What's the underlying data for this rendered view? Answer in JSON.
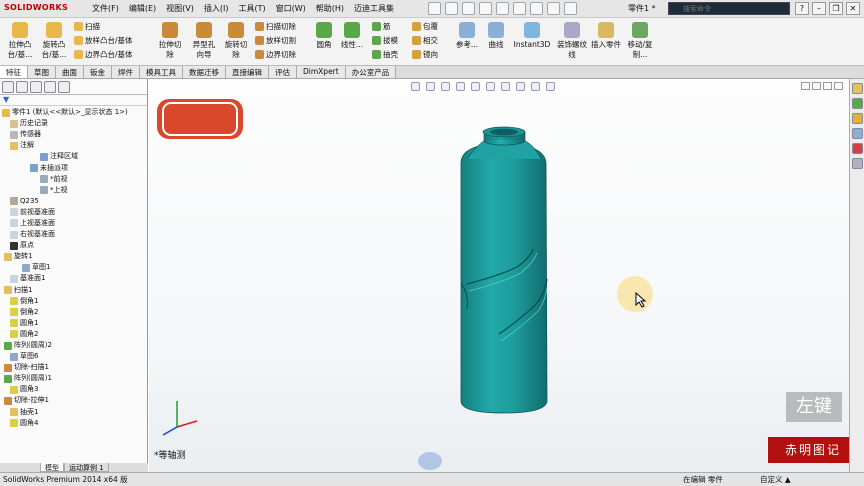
{
  "app": {
    "logo": "SOLIDWORKS",
    "menus": [
      "文件(F)",
      "编辑(E)",
      "视图(V)",
      "插入(I)",
      "工具(T)",
      "窗口(W)",
      "帮助(H)",
      "迈迪工具集"
    ],
    "doc_title": "零件1 *",
    "search_placeholder": "搜索命令"
  },
  "ribbon": {
    "big_buttons": [
      "拉伸凸台/基...",
      "旋转凸台/基...",
      "拉伸切除",
      "异型孔向导",
      "旋转切除",
      "圆角",
      "线性...",
      "参考...",
      "曲线",
      "Instant3D",
      "装饰螺纹线",
      "插入零件",
      "移动/复制..."
    ],
    "small_features": [
      "扫描",
      "放样凸台/基体",
      "边界凸台/基体"
    ],
    "small_cuts": [
      "扫描切除",
      "放样切割",
      "边界切除"
    ],
    "small_misc": [
      "筋",
      "拔模",
      "抽壳"
    ],
    "small_misc2": [
      "包覆",
      "相交",
      "镜向"
    ]
  },
  "tabs": [
    "特征",
    "草图",
    "曲面",
    "钣金",
    "焊件",
    "模具工具",
    "数据迁移",
    "直接编辑",
    "评估",
    "DimXpert",
    "办公室产品"
  ],
  "tree": {
    "root": "零件1 (默认<<默认>_显示状态 1>)",
    "items": [
      "历史记录",
      "传感器",
      "注解",
      "注释区域",
      "未插派项",
      "*前视",
      "*上视",
      "Q235",
      "前视基准面",
      "上视基准面",
      "右视基准面",
      "原点",
      "旋转1",
      "草图1",
      "基准面1",
      "扫描1",
      "倒角1",
      "倒角2",
      "圆角1",
      "圆角2",
      "阵列(圆周)2",
      "草图6",
      "切除-扫描1",
      "阵列(圆周)1",
      "圆角3",
      "切除-拉伸1",
      "抽壳1",
      "圆角4"
    ]
  },
  "bottom_tabs": [
    "模型",
    "运动算例 1"
  ],
  "viewport": {
    "orientation_label": "*等轴测",
    "stamp_text": "赤明图记",
    "key_hint": "左键",
    "watermark": "赤明图记"
  },
  "status": {
    "left": "SolidWorks Premium 2014 x64 版",
    "mid": "在编辑 零件",
    "right": "自定义 ▲"
  },
  "colors": {
    "part_teal": "#1f9a9a",
    "stamp_red": "#d9482a",
    "watermark_red": "#b31010"
  }
}
